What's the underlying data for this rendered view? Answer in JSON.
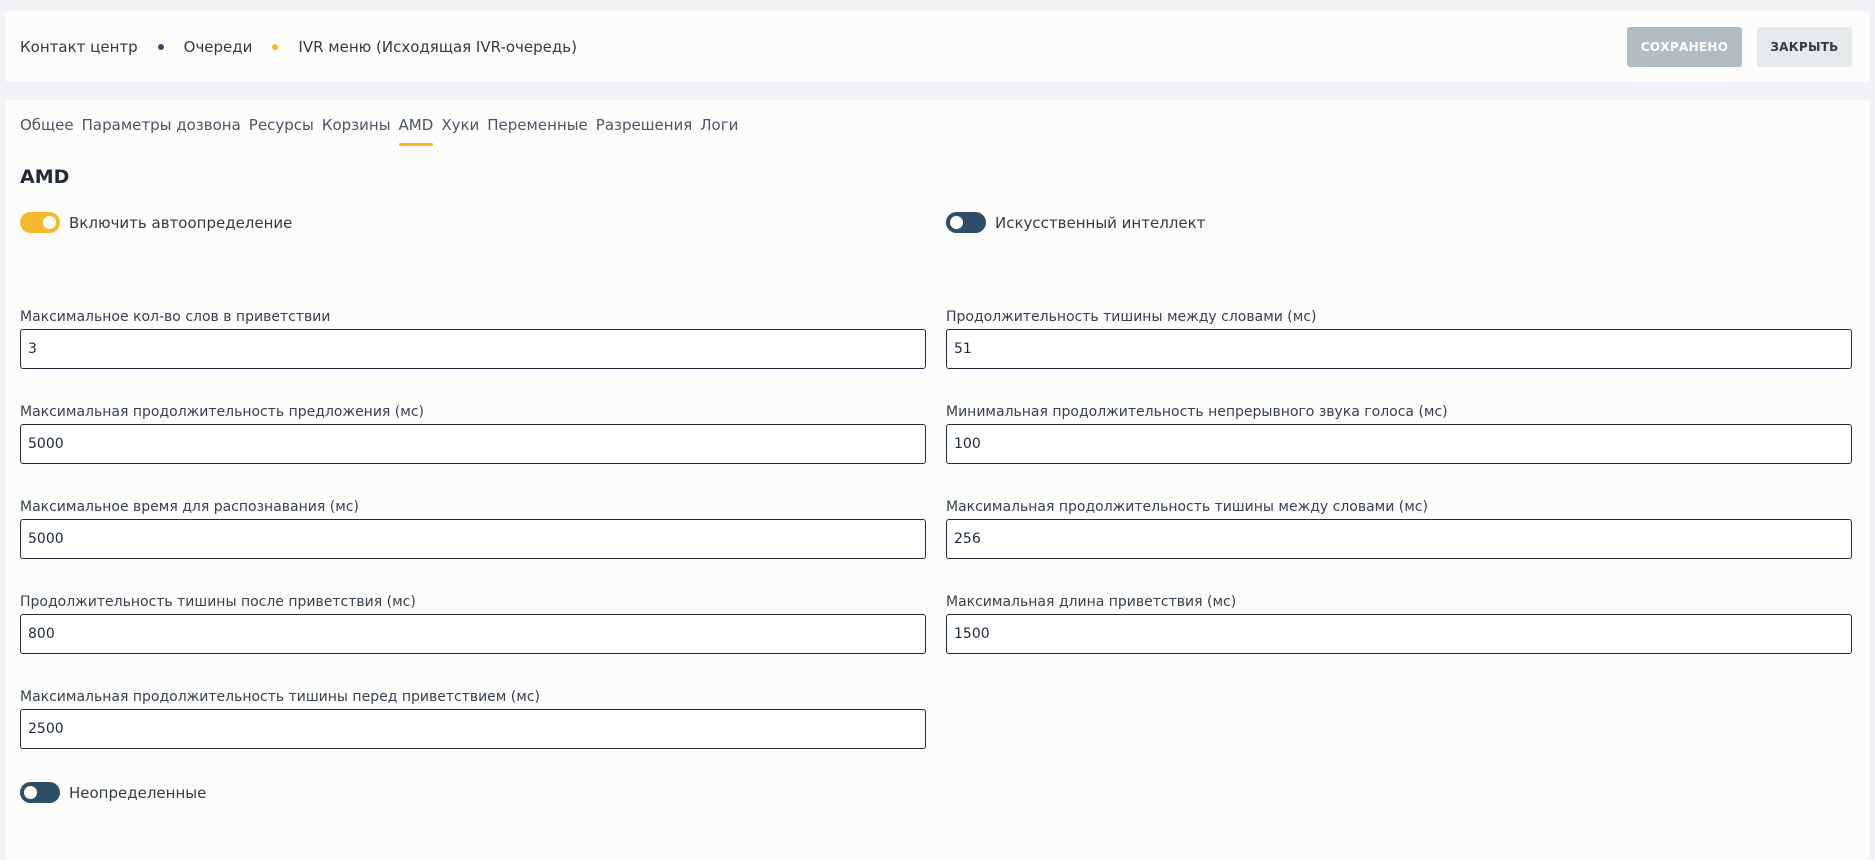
{
  "breadcrumb": {
    "items": [
      "Контакт центр",
      "Очереди",
      "IVR меню (Исходящая IVR-очередь)"
    ],
    "dot_colors": [
      "#2f4d66",
      "#f5b82e"
    ]
  },
  "header": {
    "saved_label": "СОХРАНЕНО",
    "close_label": "ЗАКРЫТЬ"
  },
  "tabs": [
    "Общее",
    "Параметры дозвона",
    "Ресурсы",
    "Корзины",
    "AMD",
    "Хуки",
    "Переменные",
    "Разрешения",
    "Логи"
  ],
  "active_tab": "AMD",
  "section": {
    "title": "AMD",
    "auto_detect_label": "Включить автоопределение",
    "auto_detect_on": true,
    "ai_label": "Искусственный интеллект",
    "ai_on": false,
    "undefined_label": "Неопределенные",
    "undefined_on": false
  },
  "fields": {
    "max_words": {
      "label": "Максимальное кол-во слов в приветствии",
      "value": "3"
    },
    "silence_between_words": {
      "label": "Продолжительность тишины между словами (мс)",
      "value": "51"
    },
    "max_sentence": {
      "label": "Максимальная продолжительность предложения (мс)",
      "value": "5000"
    },
    "min_voice": {
      "label": "Минимальная продолжительность непрерывного звука голоса (мс)",
      "value": "100"
    },
    "max_recognition": {
      "label": "Максимальное время для распознавания (мс)",
      "value": "5000"
    },
    "max_silence_between_words": {
      "label": "Максимальная продолжительность тишины между словами (мс)",
      "value": "256"
    },
    "silence_after_greeting": {
      "label": "Продолжительность тишины после приветствия (мс)",
      "value": "800"
    },
    "max_greeting_length": {
      "label": "Максимальная длина приветствия (мс)",
      "value": "1500"
    },
    "max_silence_before_greeting": {
      "label": "Максимальная продолжительность тишины перед приветствием (мс)",
      "value": "2500"
    }
  },
  "colors": {
    "accent": "#f5b82e",
    "toggle_off": "#2f4d66",
    "saved_button": "#b2bcc4"
  }
}
